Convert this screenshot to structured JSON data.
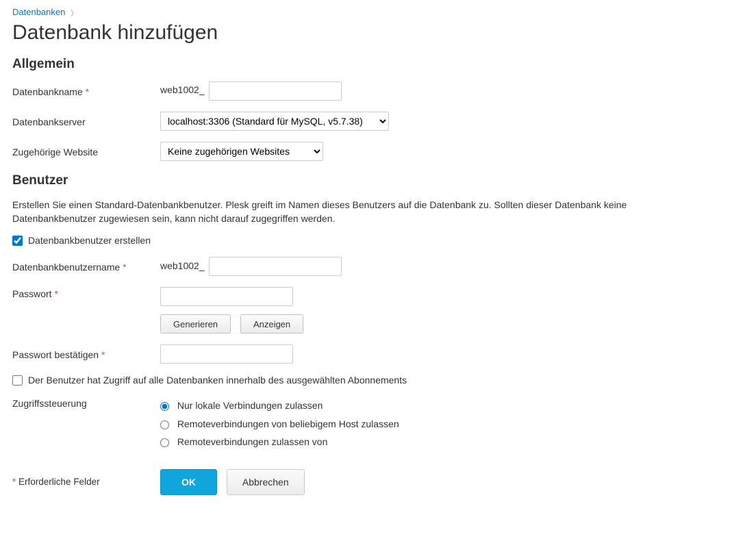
{
  "breadcrumb": {
    "link": "Datenbanken"
  },
  "title": "Datenbank hinzufügen",
  "sections": {
    "general": "Allgemein",
    "users": "Benutzer"
  },
  "general": {
    "dbname_label": "Datenbankname",
    "dbname_prefix": "web1002_",
    "dbname_value": "",
    "dbserver_label": "Datenbankserver",
    "dbserver_selected": "localhost:3306 (Standard für MySQL, v5.7.38)",
    "website_label": "Zugehörige Website",
    "website_selected": "Keine zugehörigen Websites"
  },
  "users": {
    "description": "Erstellen Sie einen Standard-Datenbankbenutzer. Plesk greift im Namen dieses Benutzers auf die Datenbank zu. Sollten dieser Datenbank keine Datenbankbenutzer zugewiesen sein, kann nicht darauf zugegriffen werden.",
    "create_user_label": "Datenbankbenutzer erstellen",
    "create_user_checked": true,
    "username_label": "Datenbankbenutzername",
    "username_prefix": "web1002_",
    "username_value": "",
    "password_label": "Passwort",
    "password_value": "",
    "generate_btn": "Generieren",
    "show_btn": "Anzeigen",
    "password_confirm_label": "Passwort bestätigen",
    "password_confirm_value": "",
    "access_all_label": "Der Benutzer hat Zugriff auf alle Datenbanken innerhalb des ausgewählten Abonnements",
    "access_all_checked": false,
    "access_ctrl_label": "Zugriffssteuerung",
    "radio": {
      "local": "Nur lokale Verbindungen zulassen",
      "anyhost": "Remoteverbindungen von beliebigem Host zulassen",
      "fromhost": "Remoteverbindungen zulassen von"
    }
  },
  "footer": {
    "required_note": "Erforderliche Felder",
    "ok": "OK",
    "cancel": "Abbrechen"
  }
}
